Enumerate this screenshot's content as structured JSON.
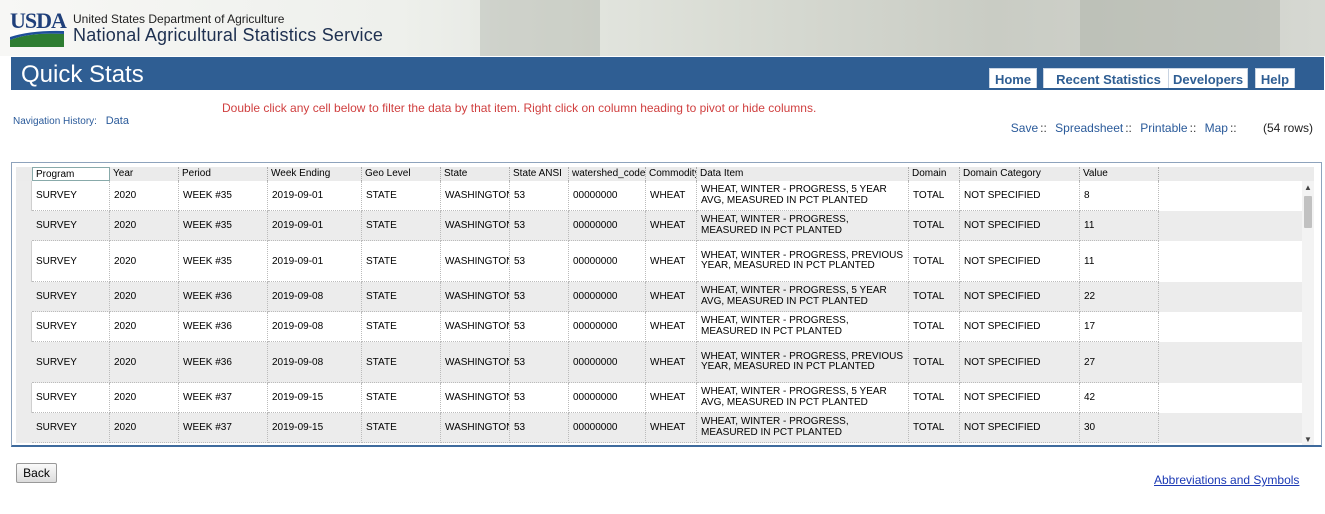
{
  "header": {
    "logo_text": "USDA",
    "department": "United States Department of Agriculture",
    "agency": "National Agricultural Statistics Service"
  },
  "titlebar": {
    "title": "Quick Stats",
    "nav": [
      "Home",
      "Recent Statistics",
      "Developers",
      "Help"
    ]
  },
  "instructions": "Double click any cell below to filter the data by that item. Right click on column heading to pivot or hide columns.",
  "nav_history": {
    "label": "Navigation History:",
    "crumb": "Data"
  },
  "actions": {
    "save": "Save",
    "spreadsheet": "Spreadsheet",
    "printable": "Printable",
    "map": "Map",
    "separator": "::",
    "row_count": "(54 rows)"
  },
  "table": {
    "columns": [
      "Program",
      "Year",
      "Period",
      "Week Ending",
      "Geo Level",
      "State",
      "State ANSI",
      "watershed_code",
      "Commodity",
      "Data Item",
      "Domain",
      "Domain Category",
      "Value"
    ],
    "rows": [
      [
        "SURVEY",
        "2020",
        "WEEK #35",
        "2019-09-01",
        "STATE",
        "WASHINGTON",
        "53",
        "00000000",
        "WHEAT",
        "WHEAT, WINTER - PROGRESS, 5 YEAR AVG, MEASURED IN PCT PLANTED",
        "TOTAL",
        "NOT SPECIFIED",
        "8"
      ],
      [
        "SURVEY",
        "2020",
        "WEEK #35",
        "2019-09-01",
        "STATE",
        "WASHINGTON",
        "53",
        "00000000",
        "WHEAT",
        "WHEAT, WINTER - PROGRESS, MEASURED IN PCT PLANTED",
        "TOTAL",
        "NOT SPECIFIED",
        "11"
      ],
      [
        "SURVEY",
        "2020",
        "WEEK #35",
        "2019-09-01",
        "STATE",
        "WASHINGTON",
        "53",
        "00000000",
        "WHEAT",
        "WHEAT, WINTER - PROGRESS, PREVIOUS YEAR, MEASURED IN PCT PLANTED",
        "TOTAL",
        "NOT SPECIFIED",
        "11"
      ],
      [
        "SURVEY",
        "2020",
        "WEEK #36",
        "2019-09-08",
        "STATE",
        "WASHINGTON",
        "53",
        "00000000",
        "WHEAT",
        "WHEAT, WINTER - PROGRESS, 5 YEAR AVG, MEASURED IN PCT PLANTED",
        "TOTAL",
        "NOT SPECIFIED",
        "22"
      ],
      [
        "SURVEY",
        "2020",
        "WEEK #36",
        "2019-09-08",
        "STATE",
        "WASHINGTON",
        "53",
        "00000000",
        "WHEAT",
        "WHEAT, WINTER - PROGRESS, MEASURED IN PCT PLANTED",
        "TOTAL",
        "NOT SPECIFIED",
        "17"
      ],
      [
        "SURVEY",
        "2020",
        "WEEK #36",
        "2019-09-08",
        "STATE",
        "WASHINGTON",
        "53",
        "00000000",
        "WHEAT",
        "WHEAT, WINTER - PROGRESS, PREVIOUS YEAR, MEASURED IN PCT PLANTED",
        "TOTAL",
        "NOT SPECIFIED",
        "27"
      ],
      [
        "SURVEY",
        "2020",
        "WEEK #37",
        "2019-09-15",
        "STATE",
        "WASHINGTON",
        "53",
        "00000000",
        "WHEAT",
        "WHEAT, WINTER - PROGRESS, 5 YEAR AVG, MEASURED IN PCT PLANTED",
        "TOTAL",
        "NOT SPECIFIED",
        "42"
      ],
      [
        "SURVEY",
        "2020",
        "WEEK #37",
        "2019-09-15",
        "STATE",
        "WASHINGTON",
        "53",
        "00000000",
        "WHEAT",
        "WHEAT, WINTER - PROGRESS, MEASURED IN PCT PLANTED",
        "TOTAL",
        "NOT SPECIFIED",
        "30"
      ]
    ]
  },
  "footer": {
    "back": "Back",
    "abbrev_link": "Abbreviations and Symbols"
  },
  "colors": {
    "brand_blue": "#2f5e93",
    "link_blue": "#2a5a9a",
    "instruction_red": "#d04040"
  }
}
